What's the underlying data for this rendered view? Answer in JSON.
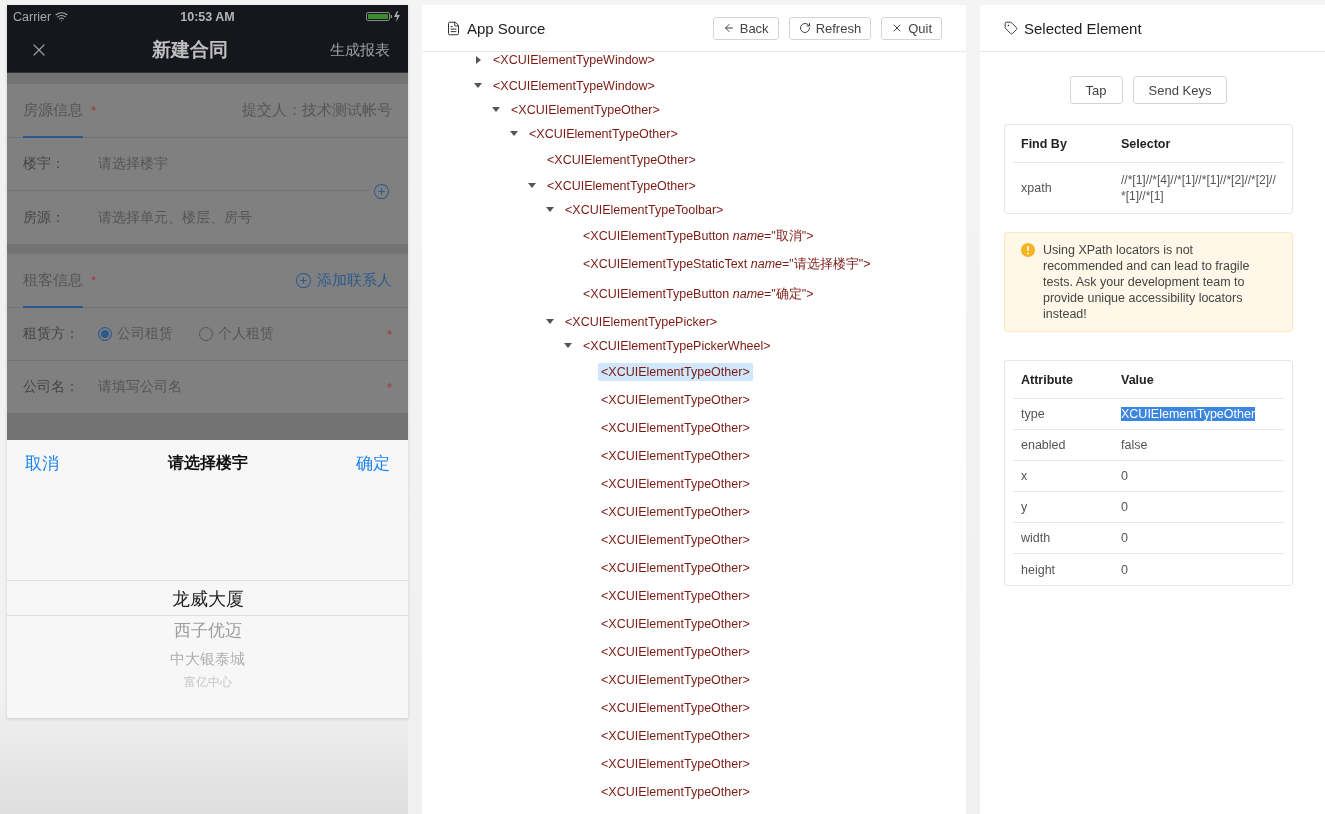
{
  "phone": {
    "status_bar": {
      "carrier": "Carrier",
      "time": "10:53 AM"
    },
    "nav": {
      "title": "新建合同",
      "action": "生成报表"
    },
    "sections": [
      {
        "title": "房源信息",
        "required": "*",
        "aside": "提交人：技术测试帐号",
        "add_icon": true,
        "fields": [
          {
            "kind": "input",
            "label": "楼宇：",
            "placeholder": "请选择楼宇"
          },
          {
            "kind": "input",
            "label": "房源：",
            "placeholder": "请选择单元、楼层、房号"
          }
        ]
      },
      {
        "title": "租客信息",
        "required": "*",
        "action": "添加联系人",
        "fields": [
          {
            "kind": "radio",
            "label": "租赁方：",
            "options": [
              {
                "label": "公司租赁",
                "selected": true
              },
              {
                "label": "个人租赁",
                "selected": false
              }
            ],
            "required": "*"
          },
          {
            "kind": "input",
            "label": "公司名：",
            "placeholder": "请填写公司名",
            "required": "*"
          }
        ]
      }
    ],
    "picker": {
      "cancel": "取消",
      "title": "请选择楼宇",
      "confirm": "确定",
      "items": [
        {
          "label": "龙威大厦",
          "selected": true
        },
        {
          "label": "西子优迈",
          "selected": false
        },
        {
          "label": "中大银泰城",
          "selected": false
        },
        {
          "label": "富亿中心",
          "selected": false
        }
      ]
    }
  },
  "app_source": {
    "title": "App Source",
    "buttons": [
      {
        "label": "Back",
        "kind": "back"
      },
      {
        "label": "Refresh",
        "kind": "refresh"
      },
      {
        "label": "Quit",
        "kind": "quit"
      }
    ],
    "tree": [
      {
        "label": "<XCUIElementTypeWindow>",
        "expanded": false,
        "selected": false
      },
      {
        "label": "<XCUIElementTypeWindow>",
        "expanded": true,
        "selected": false,
        "children": [
          {
            "label": "<XCUIElementTypeOther>",
            "expanded": true,
            "selected": false,
            "children": [
              {
                "label": "<XCUIElementTypeOther>",
                "expanded": true,
                "selected": false,
                "children": [
                  {
                    "label": "<XCUIElementTypeOther>",
                    "selected": false
                  },
                  {
                    "label": "<XCUIElementTypeOther>",
                    "expanded": true,
                    "selected": false,
                    "children": [
                      {
                        "label": "<XCUIElementTypeToolbar>",
                        "expanded": true,
                        "selected": false,
                        "children": [
                          {
                            "label": "<XCUIElementTypeButton *name*=\"取消\">",
                            "selected": false
                          },
                          {
                            "label": "<XCUIElementTypeStaticText *name*=\"请选择楼宇\">",
                            "selected": false
                          },
                          {
                            "label": "<XCUIElementTypeButton *name*=\"确定\">",
                            "selected": false
                          }
                        ]
                      },
                      {
                        "label": "<XCUIElementTypePicker>",
                        "expanded": true,
                        "selected": false,
                        "children": [
                          {
                            "label": "<XCUIElementTypePickerWheel>",
                            "expanded": true,
                            "selected": false,
                            "children": [
                              {
                                "label": "<XCUIElementTypeOther>",
                                "selected": true
                              },
                              {
                                "label": "<XCUIElementTypeOther>",
                                "selected": false
                              },
                              {
                                "label": "<XCUIElementTypeOther>",
                                "selected": false
                              },
                              {
                                "label": "<XCUIElementTypeOther>",
                                "selected": false
                              },
                              {
                                "label": "<XCUIElementTypeOther>",
                                "selected": false
                              },
                              {
                                "label": "<XCUIElementTypeOther>",
                                "selected": false
                              },
                              {
                                "label": "<XCUIElementTypeOther>",
                                "selected": false
                              },
                              {
                                "label": "<XCUIElementTypeOther>",
                                "selected": false
                              },
                              {
                                "label": "<XCUIElementTypeOther>",
                                "selected": false
                              },
                              {
                                "label": "<XCUIElementTypeOther>",
                                "selected": false
                              },
                              {
                                "label": "<XCUIElementTypeOther>",
                                "selected": false
                              },
                              {
                                "label": "<XCUIElementTypeOther>",
                                "selected": false
                              },
                              {
                                "label": "<XCUIElementTypeOther>",
                                "selected": false
                              },
                              {
                                "label": "<XCUIElementTypeOther>",
                                "selected": false
                              },
                              {
                                "label": "<XCUIElementTypeOther>",
                                "selected": false
                              },
                              {
                                "label": "<XCUIElementTypeOther>",
                                "selected": false
                              }
                            ]
                          }
                        ]
                      }
                    ]
                  }
                ]
              }
            ]
          }
        ]
      }
    ]
  },
  "selected_element": {
    "title": "Selected Element",
    "actions": [
      "Tap",
      "Send Keys"
    ],
    "find_by": {
      "columns": [
        "Find By",
        "Selector"
      ],
      "rows": [
        [
          "xpath",
          "//*[1]//*[4]//*[1]//*[1]//*[2]//*[2]//*[1]//*[1]"
        ]
      ]
    },
    "warning": "Using XPath locators is not recommended and can lead to fragile tests. Ask your development team to provide unique accessibility locators instead!",
    "attributes": {
      "columns": [
        "Attribute",
        "Value"
      ],
      "rows": [
        {
          "name": "type",
          "value": "XCUIElementTypeOther",
          "highlighted": true
        },
        {
          "name": "enabled",
          "value": "false",
          "highlighted": false
        },
        {
          "name": "x",
          "value": "0",
          "highlighted": false
        },
        {
          "name": "y",
          "value": "0",
          "highlighted": false
        },
        {
          "name": "width",
          "value": "0",
          "highlighted": false
        },
        {
          "name": "height",
          "value": "0",
          "highlighted": false
        }
      ]
    }
  }
}
